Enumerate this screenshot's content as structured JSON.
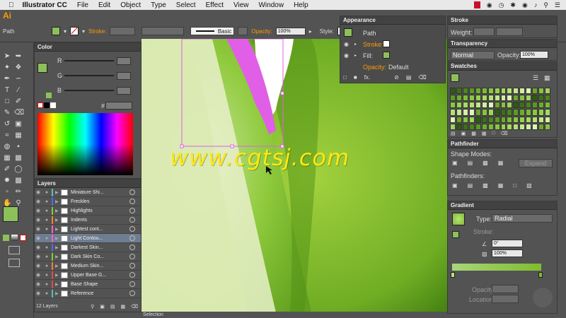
{
  "menubar": {
    "app": "Illustrator CC",
    "items": [
      "File",
      "Edit",
      "Object",
      "Type",
      "Select",
      "Effect",
      "View",
      "Window",
      "Help"
    ]
  },
  "control": {
    "selection": "Path",
    "stroke_label": "Stroke:",
    "brush": "Basic",
    "opacity_label": "Opacity:",
    "opacity": "100%",
    "style_label": "Style:"
  },
  "logo": "Ai",
  "color_panel": {
    "title": "Color",
    "r": "R",
    "g": "G",
    "b": "B",
    "hash": "#"
  },
  "layers_panel": {
    "title": "Layers",
    "count": "12 Layers",
    "items": [
      {
        "name": "Miniature Shi...",
        "color": "#4cc4c4"
      },
      {
        "name": "Freckles",
        "color": "#4a6cff"
      },
      {
        "name": "Highlights",
        "color": "#7ed321"
      },
      {
        "name": "Indents",
        "color": "#ff7f2a"
      },
      {
        "name": "Lightest cont...",
        "color": "#ff5fd0"
      },
      {
        "name": "Light Contou...",
        "color": "#ff5fd0",
        "selected": true
      },
      {
        "name": "Darkest Skin...",
        "color": "#4a6cff"
      },
      {
        "name": "Dark Skin Co...",
        "color": "#7ed321"
      },
      {
        "name": "Medium Skin...",
        "color": "#ff7f2a"
      },
      {
        "name": "Upper Base G...",
        "color": "#e04c4c"
      },
      {
        "name": "Base Shape",
        "color": "#e04c4c"
      },
      {
        "name": "Reference",
        "color": "#4cc4c4"
      }
    ]
  },
  "appearance": {
    "title": "Appearance",
    "path": "Path",
    "stroke": "Stroke:",
    "fill": "Fill:",
    "opacity": "Opacity:",
    "opacity_value": "Default",
    "fx": "fx."
  },
  "stroke_panel": {
    "title": "Stroke",
    "weight": "Weight:"
  },
  "transparency": {
    "title": "Transparency",
    "mode": "Normal",
    "opacity_label": "Opacity:",
    "opacity": "100%"
  },
  "swatches": {
    "title": "Swatches"
  },
  "pathfinder": {
    "title": "Pathfinder",
    "shape_modes": "Shape Modes:",
    "expand": "Expand",
    "pathfinders": "Pathfinders:"
  },
  "gradient": {
    "title": "Gradient",
    "type_label": "Type:",
    "type": "Radial",
    "stroke_label": "Stroke:",
    "angle": "0°",
    "ratio": "100%",
    "opacity_label": "Opacity:",
    "location_label": "Location:"
  },
  "status": "Selection",
  "watermark": "www.cgtsj.com",
  "colors": {
    "accent": "#ff9a00",
    "lime": "#7fbd2f",
    "fill": "#8dc05a"
  }
}
